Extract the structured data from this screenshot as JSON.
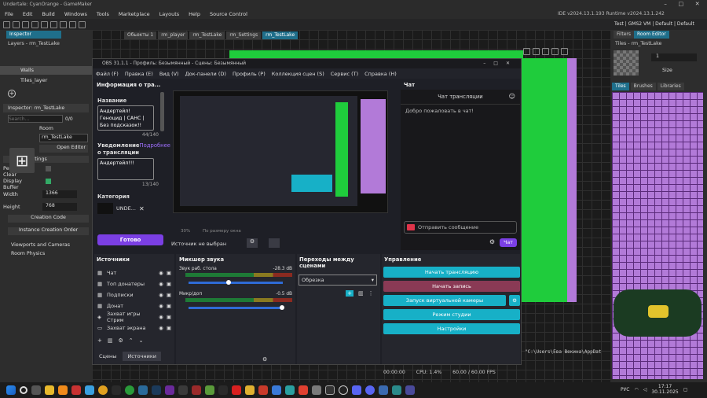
{
  "gm": {
    "title": "Undertale: CyanOrange - GameMaker",
    "menu": [
      "File",
      "Edit",
      "Build",
      "Windows",
      "Tools",
      "Marketplace",
      "Layouts",
      "Help",
      "Source Control"
    ],
    "ide_version": "IDE v2024.13.1.193  Runtime v2024.13.1.242",
    "target": "Test | GMS2 VM | Default | Default",
    "inspector_tab": "Inspector",
    "layers_title": "Layers - rm_TestLake",
    "layers": [
      "Walls",
      "Tiles_layer"
    ],
    "inspector_title": "Inspector: rm_TestLake",
    "search_placeholder": "Search...",
    "count": "0/0",
    "room_label": "Room",
    "room_name": "rm_TestLake",
    "open_editor": "Open Editor",
    "room_settings": "Room Settings",
    "persistent": "Persistent",
    "clear_display": "Clear Display Buffer",
    "width_label": "Width",
    "width_val": "1366",
    "height_label": "Height",
    "height_val": "768",
    "creation_code": "Creation Code",
    "instance_order": "Instance Creation Order",
    "viewports": "Viewports and Cameras",
    "room_physics": "Room Physics",
    "editor_tabs": [
      "Обьекты 1",
      "rm_player",
      "rm_TestLake",
      "rm_Settings",
      "rm_TestLake"
    ],
    "right_tabs": [
      "Filters",
      "Room Editor"
    ],
    "tiles_title": "Tiles - rm_TestLake",
    "tiles_tabs": [
      "Tiles",
      "Brushes",
      "Libraries"
    ],
    "size_label": "Size",
    "brush_val": "1",
    "console": "\"C:\\Users\\Ева Векина\\AppDat"
  },
  "obs": {
    "title": "OBS 31.1.1 - Профиль: Безымянный - Сцены: Безымянный",
    "menu": [
      "Файл (F)",
      "Правка (E)",
      "Вид (V)",
      "Док-панели (D)",
      "Профиль (P)",
      "Коллекция сцен (S)",
      "Сервис (T)",
      "Справка (H)"
    ],
    "info_title": "Информация о тра...",
    "name_label": "Название",
    "name_val": "Андертейл! Геноцид | САНС | Без подсказок!!",
    "name_count": "44/140",
    "notif_label": "Уведомление",
    "notif_link": "Подробнее",
    "notif_label2": "о трансляции",
    "notif_val": "Андертейл!!!",
    "notif_count": "13/140",
    "category_label": "Категория",
    "category_val": "UNDE...",
    "done": "Готово",
    "zoom": "30%",
    "zoom_mode": "По размеру окна",
    "source_none": "Источник не выбран",
    "chat_title": "Чат",
    "chat_header": "Чат трансляции",
    "chat_welcome": "Добро пожаловать в чат!",
    "chat_send": "Отправить сообщение",
    "chat_btn": "Чат",
    "sources_title": "Источники",
    "sources": [
      "Чат",
      "Топ донатеры",
      "Подписки",
      "Донат",
      "Захват игры Стрим",
      "Захват экрана"
    ],
    "mixer_title": "Микшер звука",
    "mix1": "Звук раб. стола",
    "mix1_db": "-28.3 dB",
    "mix2": "Микр/доп",
    "mix2_db": "-0.5 dB",
    "trans_title": "Переходы между сценами",
    "trans_val": "Обрезка",
    "controls_title": "Управление",
    "ctrl": [
      "Начать трансляцию",
      "Начать запись",
      "Запуск виртуальной камеры",
      "Режим студии",
      "Настройки"
    ],
    "tab_scenes": "Сцены",
    "tab_sources": "Источники",
    "status_time": "00:00:00",
    "status_cpu": "CPU: 1.4%",
    "status_fps": "60.00 / 60.00 FPS"
  },
  "taskbar": {
    "lang": "РУС",
    "time": "17:17",
    "date": "30.11.2025"
  },
  "colors": {
    "teal": "#17b0c7",
    "rec": "#8a3a55",
    "purple": "#7b3fe4",
    "green": "#1fcc3c",
    "tile_purple": "#b27ad8"
  }
}
